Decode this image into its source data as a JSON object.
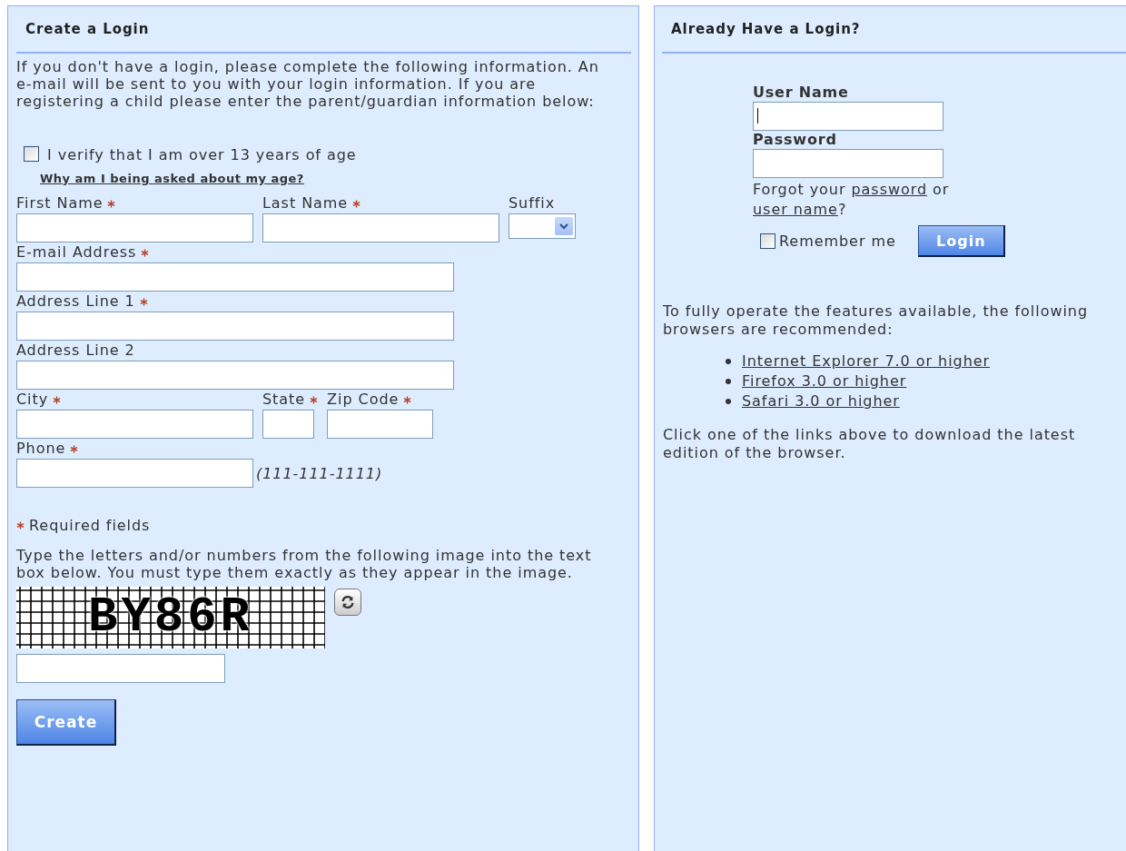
{
  "create_panel": {
    "title": "Create a Login",
    "intro": "If you don't have a login, please complete the following information. An e-mail will be sent to you with your login information. If you are registering a child please enter the parent/guardian information below:",
    "age_check": {
      "label": "I verify that I am over 13 years of age",
      "checked": false
    },
    "age_link": "Why am I being asked about my age?",
    "field_rows": [
      [
        {
          "label": "First Name",
          "required": true,
          "kind": "text"
        },
        {
          "label": "Last Name",
          "required": true,
          "kind": "text"
        },
        {
          "label": "Suffix",
          "required": false,
          "kind": "select"
        }
      ],
      [
        {
          "label": "E-mail Address",
          "required": true,
          "kind": "text"
        }
      ],
      [
        {
          "label": "Address Line 1",
          "required": true,
          "kind": "text"
        }
      ],
      [
        {
          "label": "Address Line 2",
          "required": false,
          "kind": "text"
        }
      ],
      [
        {
          "label": "City",
          "required": true,
          "kind": "text"
        },
        {
          "label": "State",
          "required": true,
          "kind": "text"
        },
        {
          "label": "Zip Code",
          "required": true,
          "kind": "text"
        }
      ],
      [
        {
          "label": "Phone",
          "required": true,
          "kind": "text",
          "hint": "(111-111-1111)"
        }
      ]
    ],
    "required_note": "Required fields",
    "captcha_instructions": "Type the letters and/or numbers from the following image into the text box below. You must type them exactly as they appear in the image.",
    "captcha_text": "BY86R",
    "create_button": "Create"
  },
  "login_panel": {
    "title": "Already Have a Login?",
    "username_label": "User Name",
    "username_focused": true,
    "password_label": "Password",
    "forgot": [
      {
        "kind": "text",
        "text": "Forgot your "
      },
      {
        "kind": "link",
        "text": "password"
      },
      {
        "kind": "text",
        "text": " or "
      },
      {
        "kind": "link",
        "text": "user name"
      },
      {
        "kind": "text",
        "text": "?"
      }
    ],
    "remember": {
      "label": "Remember me",
      "checked": false
    },
    "login_button": "Login",
    "browsers_intro": "To fully operate the features available, the following browsers are recommended:",
    "browsers": [
      "Internet Explorer 7.0 or higher",
      "Firefox 3.0 or higher",
      "Safari 3.0 or higher"
    ],
    "browsers_note": "Click one of the links above to download the latest edition of the browser."
  }
}
